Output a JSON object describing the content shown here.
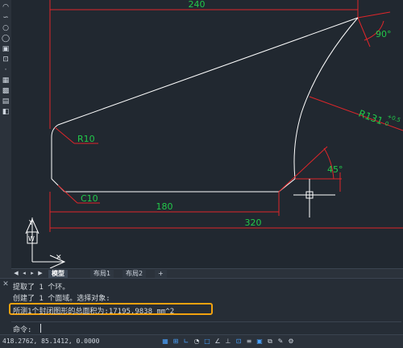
{
  "toolbar": {
    "icons": [
      "arc-icon",
      "spline-icon",
      "circle-icon",
      "ellipse-icon",
      "block-icon",
      "insert-icon",
      "point-icon",
      "hatch-icon",
      "gradient-icon",
      "table-icon",
      "region-icon"
    ]
  },
  "drawing": {
    "dimensions": {
      "top_width": "240",
      "angle_top": "90°",
      "radius_big": "R131",
      "radius_tol_upper": "+0.5",
      "radius_tol_lower": "0",
      "radius_small": "R10",
      "angle_bottom": "45°",
      "chamfer": "C10",
      "bottom_inner": "180",
      "bottom_overall": "320"
    },
    "ucs": {
      "y_label": "Y",
      "w_label": "W"
    }
  },
  "tabs": {
    "items": [
      {
        "label": "模型",
        "active": true
      },
      {
        "label": "布局1",
        "active": false
      },
      {
        "label": "布局2",
        "active": false
      },
      {
        "label": "+",
        "active": false
      }
    ]
  },
  "command": {
    "lines": [
      "提取了 1 个环。",
      "创建了 1 个面域。选择对象:",
      "所测1个封闭图形的总面积为:17195.9838 mm^2"
    ],
    "prompt": "命令:"
  },
  "status": {
    "coordinates": "418.2762, 85.1412, 0.0000",
    "buttons": [
      {
        "name": "grid-icon",
        "on": true
      },
      {
        "name": "snap-icon",
        "on": true
      },
      {
        "name": "ortho-icon",
        "on": true
      },
      {
        "name": "polar-icon",
        "on": false
      },
      {
        "name": "osnap-icon",
        "on": true
      },
      {
        "name": "otrack-icon",
        "on": false
      },
      {
        "name": "dynamic-ucs-icon",
        "on": false
      },
      {
        "name": "dynamic-input-icon",
        "on": true
      },
      {
        "name": "lineweight-icon",
        "on": false
      },
      {
        "name": "transparency-icon",
        "on": true
      },
      {
        "name": "selection-cycling-icon",
        "on": false
      },
      {
        "name": "annotation-icon",
        "on": false
      },
      {
        "name": "workspace-icon",
        "on": false
      }
    ],
    "colors": {
      "geometry": "#ffffff",
      "dimension_line": "#e0262a",
      "dimension_text": "#22c94a",
      "highlight": "#f2a20f"
    }
  }
}
